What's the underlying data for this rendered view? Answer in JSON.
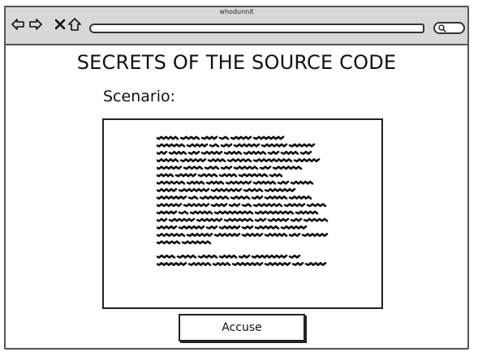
{
  "window": {
    "title": "whodunnit"
  },
  "toolbar": {
    "back_icon": "arrow-left-icon",
    "forward_icon": "arrow-right-icon",
    "close_icon": "close-x-icon",
    "home_icon": "home-icon",
    "address_value": "",
    "search_icon": "search-icon"
  },
  "main": {
    "title": "SECRETS OF THE SOURCE CODE",
    "scenario_label": "Scenario:",
    "accuse_label": "Accuse"
  }
}
